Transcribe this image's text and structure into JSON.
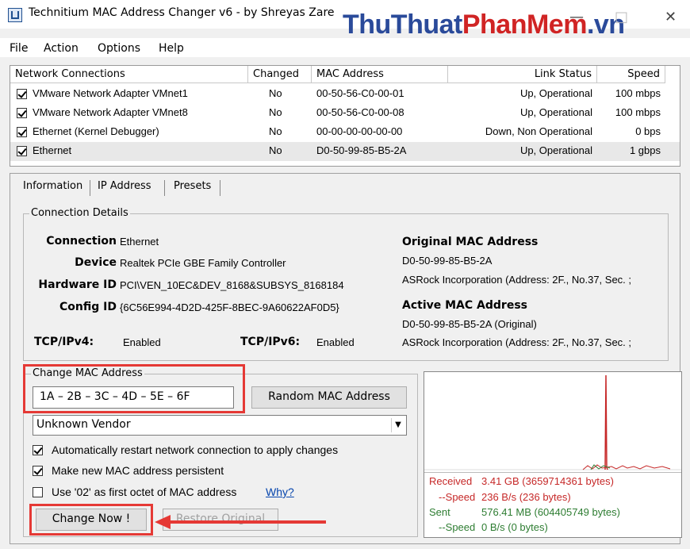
{
  "window": {
    "title": "Technitium MAC Address Changer v6 - by Shreyas Zare",
    "watermark_a": "ThuThuat",
    "watermark_b": "PhanMem",
    "watermark_c": ".vn",
    "minimize": "—",
    "maximize": "□",
    "close": "✕"
  },
  "menu": [
    "File",
    "Action",
    "Options",
    "Help"
  ],
  "table": {
    "headers": [
      "Network Connections",
      "Changed",
      "MAC Address",
      "Link Status",
      "Speed"
    ],
    "rows": [
      {
        "name": "VMware Network Adapter VMnet1",
        "changed": "No",
        "mac": "00-50-56-C0-00-01",
        "link": "Up, Operational",
        "speed": "100 mbps",
        "checked": true
      },
      {
        "name": "VMware Network Adapter VMnet8",
        "changed": "No",
        "mac": "00-50-56-C0-00-08",
        "link": "Up, Operational",
        "speed": "100 mbps",
        "checked": true
      },
      {
        "name": "Ethernet (Kernel Debugger)",
        "changed": "No",
        "mac": "00-00-00-00-00-00",
        "link": "Down, Non Operational",
        "speed": "0 bps",
        "checked": true
      },
      {
        "name": "Ethernet",
        "changed": "No",
        "mac": "D0-50-99-85-B5-2A",
        "link": "Up, Operational",
        "speed": "1 gbps",
        "checked": true,
        "selected": true
      }
    ]
  },
  "tabs": [
    "Information",
    "IP Address",
    "Presets"
  ],
  "details": {
    "group_label": "Connection Details",
    "connection_label": "Connection",
    "connection_value": "Ethernet",
    "device_label": "Device",
    "device_value": "Realtek PCIe GBE Family Controller",
    "hwid_label": "Hardware ID",
    "hwid_value": "PCI\\VEN_10EC&DEV_8168&SUBSYS_8168184",
    "configid_label": "Config ID",
    "configid_value": "{6C56E994-4D2D-425F-8BEC-9A60622AF0D5}",
    "ipv4_label": "TCP/IPv4:",
    "ipv4_value": "Enabled",
    "ipv6_label": "TCP/IPv6:",
    "ipv6_value": "Enabled",
    "orig_mac_title": "Original MAC Address",
    "orig_mac_value": "D0-50-99-85-B5-2A",
    "orig_mac_vendor": "ASRock Incorporation  (Address: 2F., No.37, Sec. ;",
    "active_mac_title": "Active MAC Address",
    "active_mac_value": "D0-50-99-85-B5-2A (Original)",
    "active_mac_vendor": "ASRock Incorporation  (Address: 2F., No.37, Sec. ;"
  },
  "change": {
    "group_label": "Change MAC Address",
    "mac_input_value": "1A  –  2B  –  3C  –  4D  –  5E  –  6F",
    "random_button": "Random MAC Address",
    "vendor_select": "Unknown Vendor",
    "opt_restart": "Automatically restart network connection to apply changes",
    "opt_persistent": "Make new MAC address persistent",
    "opt_02": "Use '02' as first octet of MAC address",
    "why_link": "Why?",
    "change_now": "Change Now !",
    "restore": "Restore Original"
  },
  "stats": {
    "received_label": "Received",
    "received_value": "3.41 GB (3659714361 bytes)",
    "recv_speed_label": "--Speed",
    "recv_speed_value": "236 B/s (236 bytes)",
    "sent_label": "Sent",
    "sent_value": "576.41 MB (604405749 bytes)",
    "sent_speed_label": "--Speed",
    "sent_speed_value": "0 B/s (0 bytes)"
  },
  "colors": {
    "highlight": "#e53935",
    "received": "#c62828",
    "sent": "#2e7d32"
  }
}
